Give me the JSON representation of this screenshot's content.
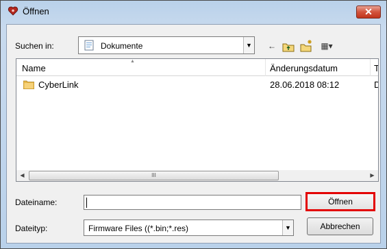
{
  "window": {
    "title": "Öffnen",
    "close_label": "✕"
  },
  "lookin": {
    "label": "Suchen in:",
    "value": "Dokumente"
  },
  "toolbar": {
    "back": "←",
    "up": "⬑",
    "new_folder": "✱",
    "view": "▦▾"
  },
  "list": {
    "columns": [
      "Name",
      "Änderungsdatum",
      "Ty"
    ],
    "rows": [
      {
        "name": "CyberLink",
        "date": "28.06.2018 08:12",
        "type": "Da"
      }
    ],
    "scroll_grip": "III"
  },
  "filename": {
    "label": "Dateiname:",
    "value": ""
  },
  "filetype": {
    "label": "Dateityp:",
    "value": "Firmware Files ((*.bin;*.res)"
  },
  "buttons": {
    "open": "Öffnen",
    "cancel": "Abbrechen"
  },
  "colors": {
    "highlight": "#e30000",
    "title_gradient": "#b9d1ea"
  }
}
